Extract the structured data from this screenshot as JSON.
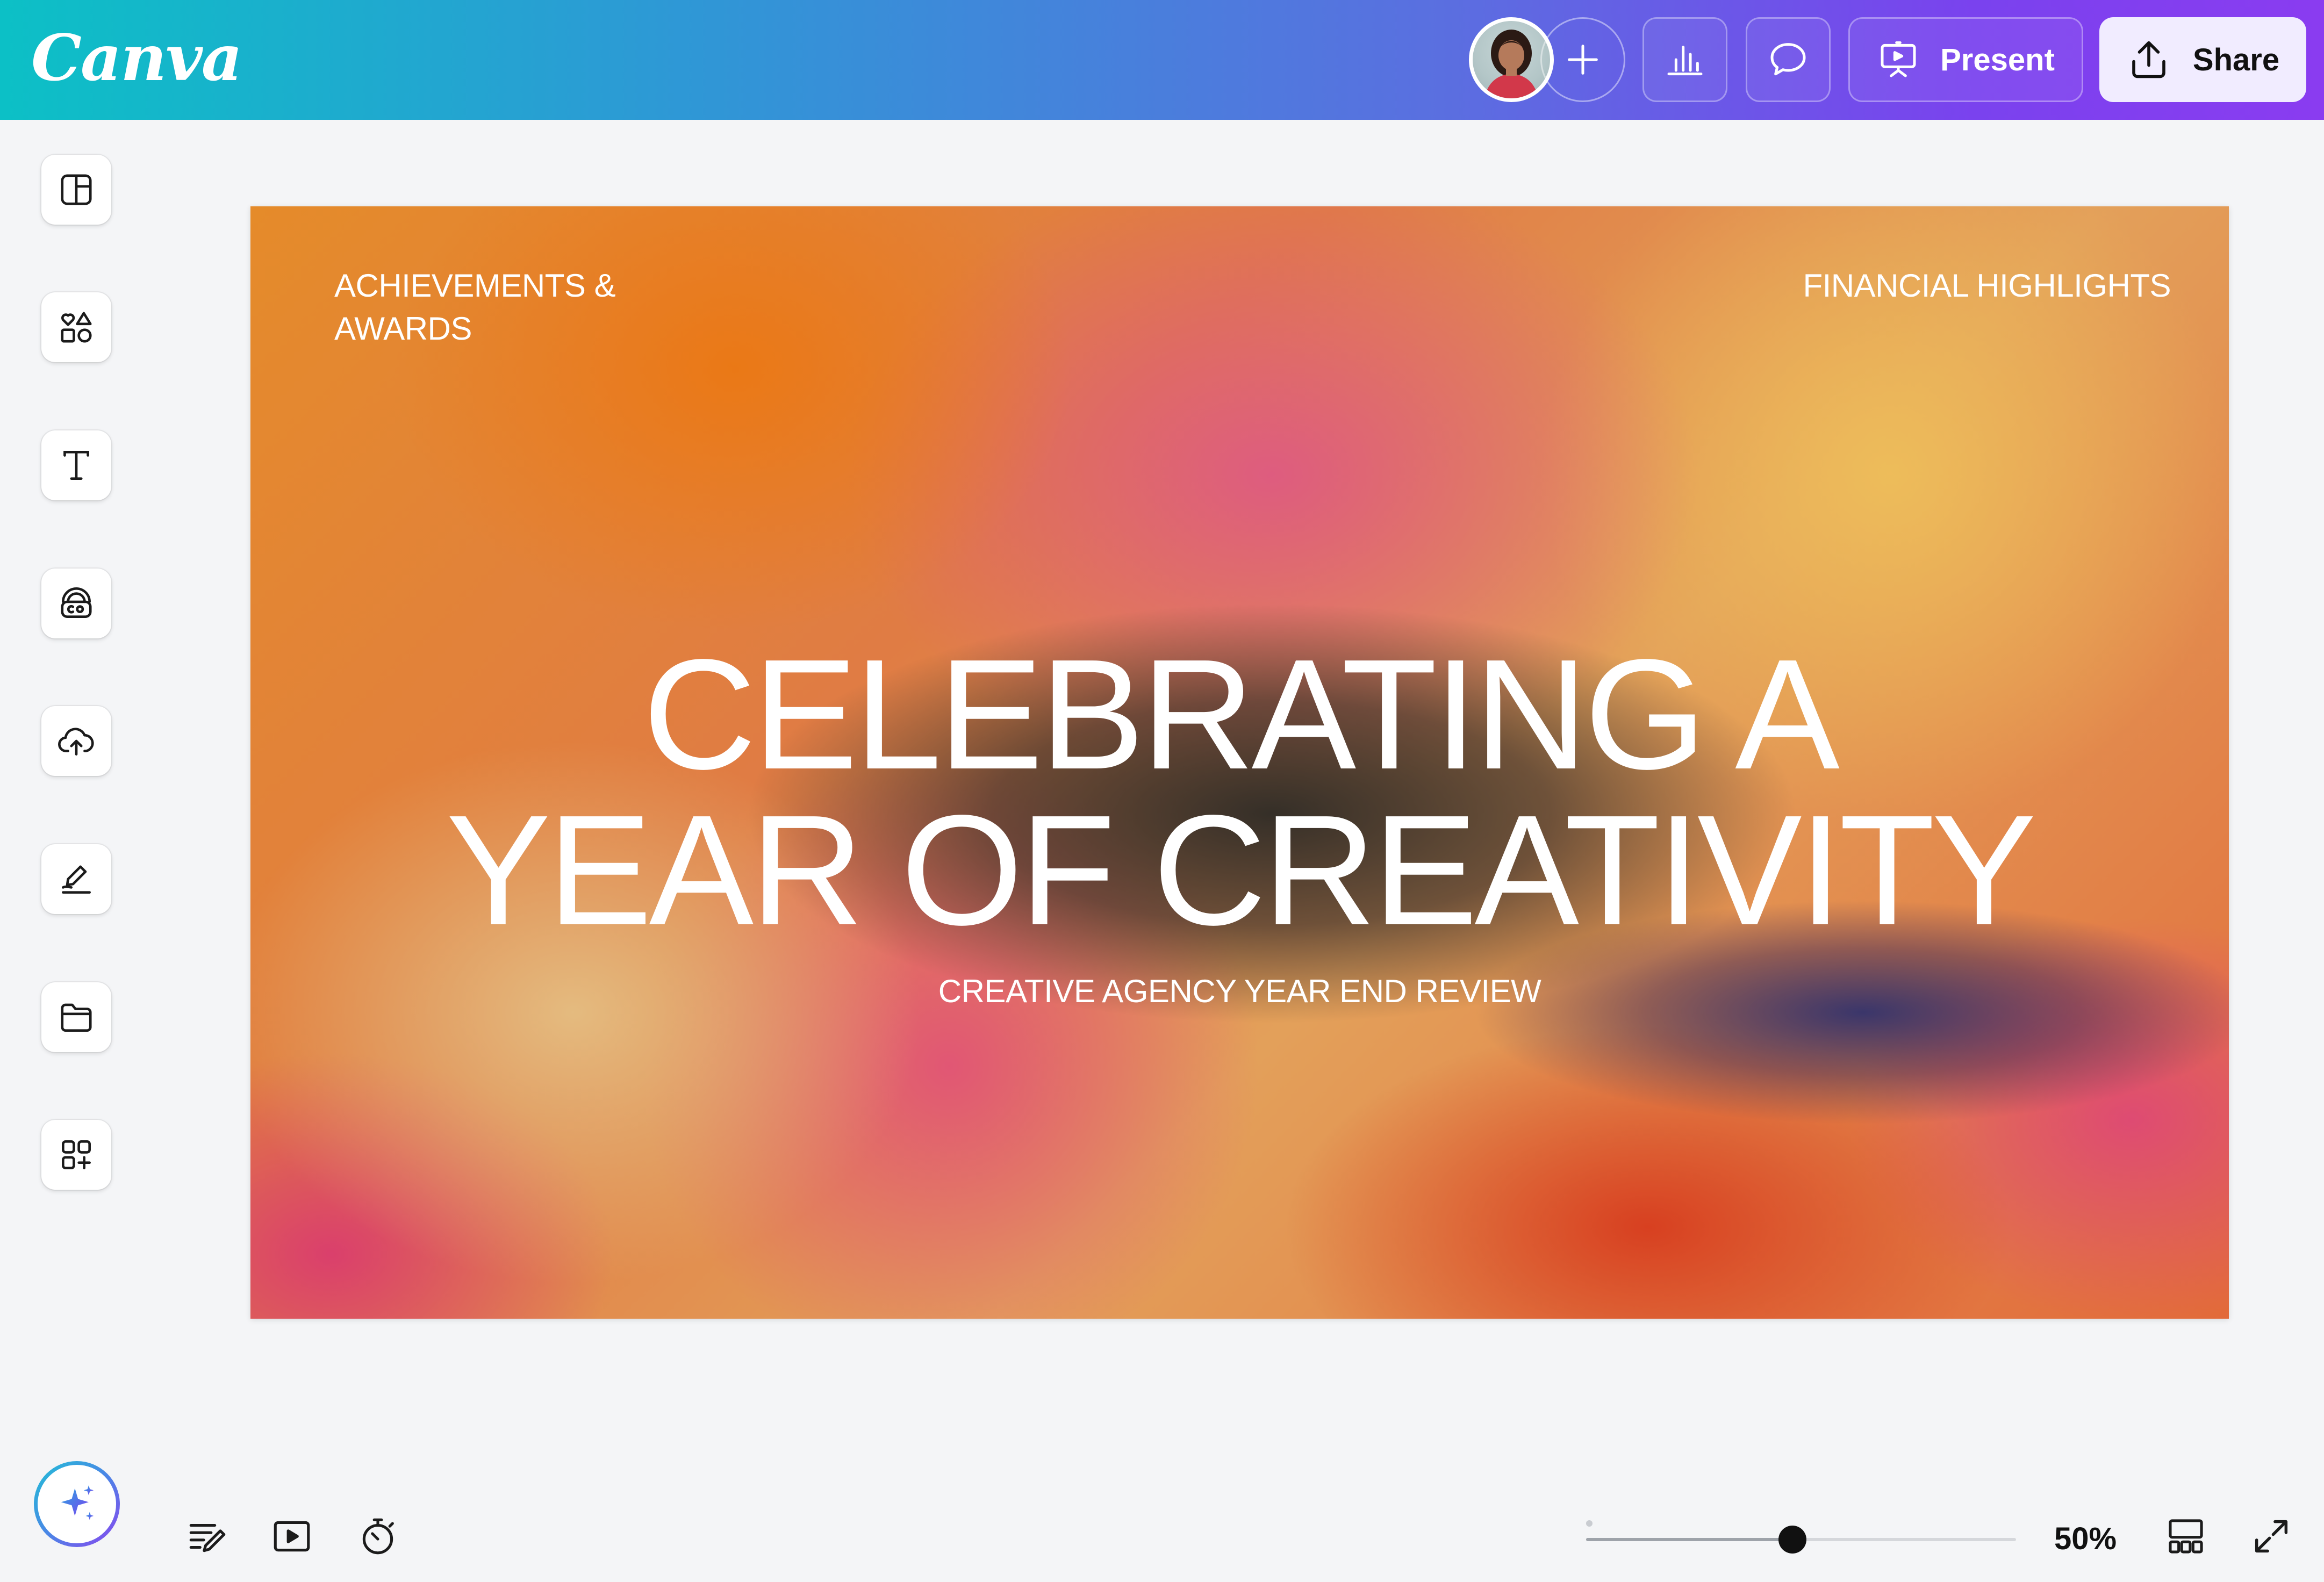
{
  "app": {
    "logo_text": "Canva"
  },
  "header": {
    "collaborator_avatar": "user-avatar",
    "present_label": "Present",
    "share_label": "Share"
  },
  "sidebar": {
    "items": [
      {
        "icon": "layout-icon"
      },
      {
        "icon": "shapes-icon"
      },
      {
        "icon": "text-icon"
      },
      {
        "icon": "brand-icon"
      },
      {
        "icon": "upload-icon"
      },
      {
        "icon": "draw-icon"
      },
      {
        "icon": "folder-icon"
      },
      {
        "icon": "apps-icon"
      }
    ]
  },
  "slide": {
    "top_left": "ACHIEVEMENTS & AWARDS",
    "top_right": "FINANCIAL HIGHLIGHTS",
    "headline_line1": "CELEBRATING A",
    "headline_line2": "YEAR OF CREATIVITY",
    "subtitle": "CREATIVE AGENCY YEAR END REVIEW"
  },
  "footer": {
    "zoom_label": "50%",
    "zoom_fraction": 0.48
  },
  "colors": {
    "accent_start": "#0cc0c6",
    "accent_end": "#8a3cf0",
    "share_bg": "#f1ecff",
    "canvas_bg": "#f4f5f7"
  }
}
